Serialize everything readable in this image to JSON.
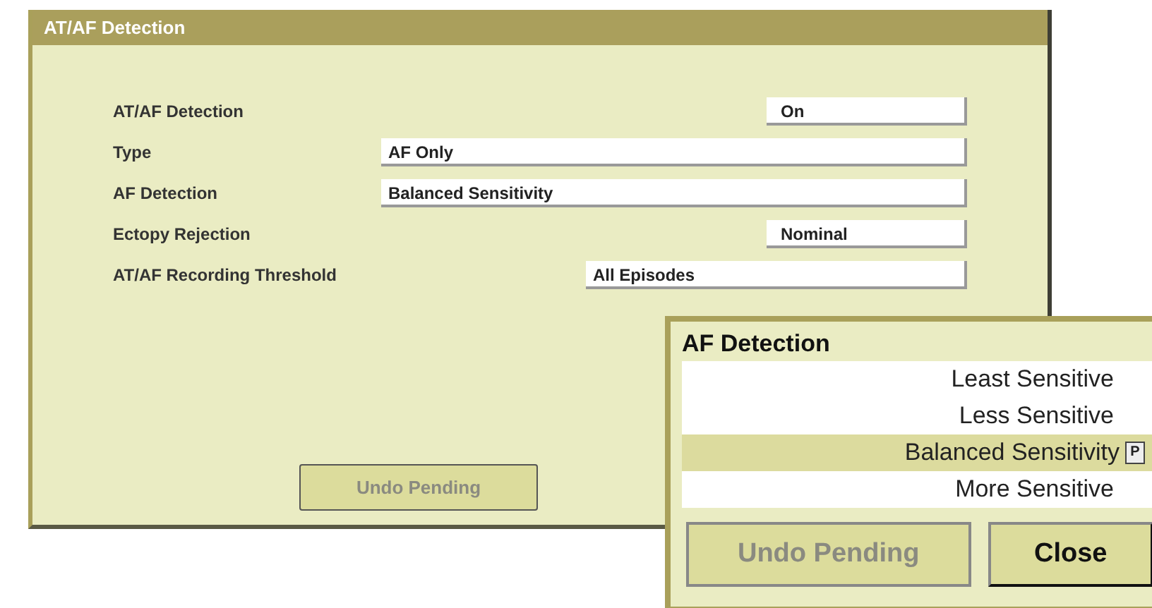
{
  "window": {
    "title": "AT/AF Detection"
  },
  "settings": [
    {
      "label": "AT/AF Detection",
      "value": "On",
      "kind": "short"
    },
    {
      "label": "Type",
      "value": "AF Only",
      "kind": "wide"
    },
    {
      "label": "AF Detection",
      "value": "Balanced Sensitivity",
      "kind": "wide"
    },
    {
      "label": "Ectopy Rejection",
      "value": "Nominal",
      "kind": "short"
    },
    {
      "label": "AT/AF Recording Threshold",
      "value": "All Episodes",
      "kind": "medium"
    }
  ],
  "buttons": [
    {
      "label": "Undo Pending",
      "disabled": true
    }
  ],
  "popup": {
    "title": "AF Detection",
    "options": [
      {
        "label": "Least Sensitive",
        "selected": false
      },
      {
        "label": "Less Sensitive",
        "selected": false
      },
      {
        "label": "Balanced Sensitivity",
        "selected": true,
        "marker": "P"
      },
      {
        "label": "More Sensitive",
        "selected": false
      }
    ],
    "buttons": [
      {
        "label": "Undo Pending",
        "disabled": true
      },
      {
        "label": "Close",
        "disabled": false
      }
    ]
  }
}
